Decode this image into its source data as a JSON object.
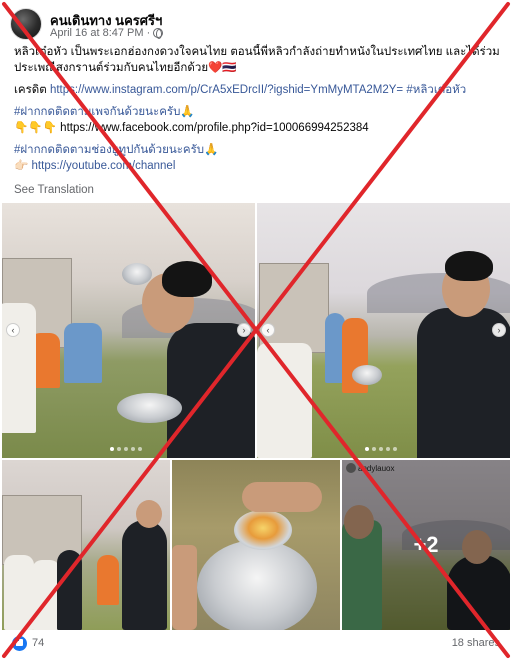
{
  "post": {
    "author": "คนเดินทาง นครศรีฯ",
    "timestamp": "April 16 at 8:47 PM",
    "audience_dot": "·",
    "audience_icon": "globe-icon",
    "lines": [
      "หลิวเต๋อหัว เป็นพระเอกฮ่องกงดวงใจคนไทย ตอนนี้พี่หลิวกำลังถ่ายทำหนังในประเทศไทย และได้ร่วมเล่น",
      "ประเพณีสงกรานต์ร่วมกับคนไทยอีกด้วย❤️🇹🇭"
    ],
    "credit_label": "เครดิต",
    "credit_link": "https://www.instagram.com/p/CrA5xEDrcII/?igshid=YmMyMTA2M2Y=",
    "credit_tag": "#หลิวเต๋อหัว",
    "follow_fb_tag": "#ฝากกดติดตามเพจกันด้วยนะครับ🙏",
    "fb_prefix": "👇👇👇",
    "fb_link": "https://www.facebook.com/profile.php?id=100066994252384",
    "follow_yt_tag": "#ฝากกดติดตามช่องยูทูปกันด้วยนะครับ🙏",
    "yt_prefix": "👉🏻",
    "yt_link": "https://youtube.com/channel",
    "see_translation": "See Translation"
  },
  "photos": {
    "more_count": "+2",
    "ig_handle": "andylauox"
  },
  "footer": {
    "like_count": "74",
    "shares": "18 shares"
  },
  "colors": {
    "cross": "#e0262b",
    "link": "#385898",
    "facebook_blue": "#1877f2"
  }
}
